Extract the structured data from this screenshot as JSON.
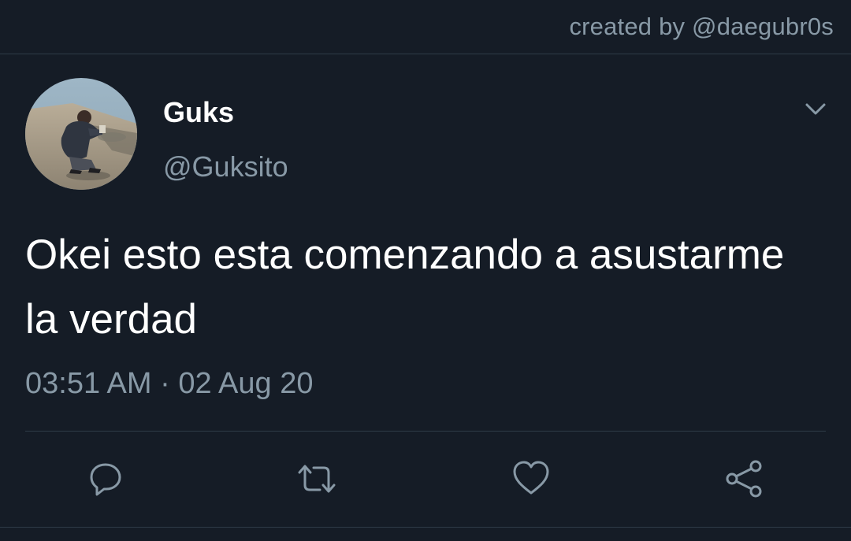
{
  "header": {
    "creator_text": "created by @daegubr0s"
  },
  "tweet": {
    "author": {
      "display_name": "Guks",
      "handle": "@Guksito"
    },
    "text": "Okei esto esta comenzando a asustarme la verdad",
    "timestamp": "03:51 AM · 02 Aug 20"
  },
  "icons": {
    "menu": "chevron-down-icon",
    "reply": "reply-icon",
    "retweet": "retweet-icon",
    "like": "heart-icon",
    "share": "share-icon"
  },
  "colors": {
    "background": "#151c26",
    "primary_text": "#ffffff",
    "secondary_text": "#8899a6",
    "divider": "#2f3b48"
  }
}
